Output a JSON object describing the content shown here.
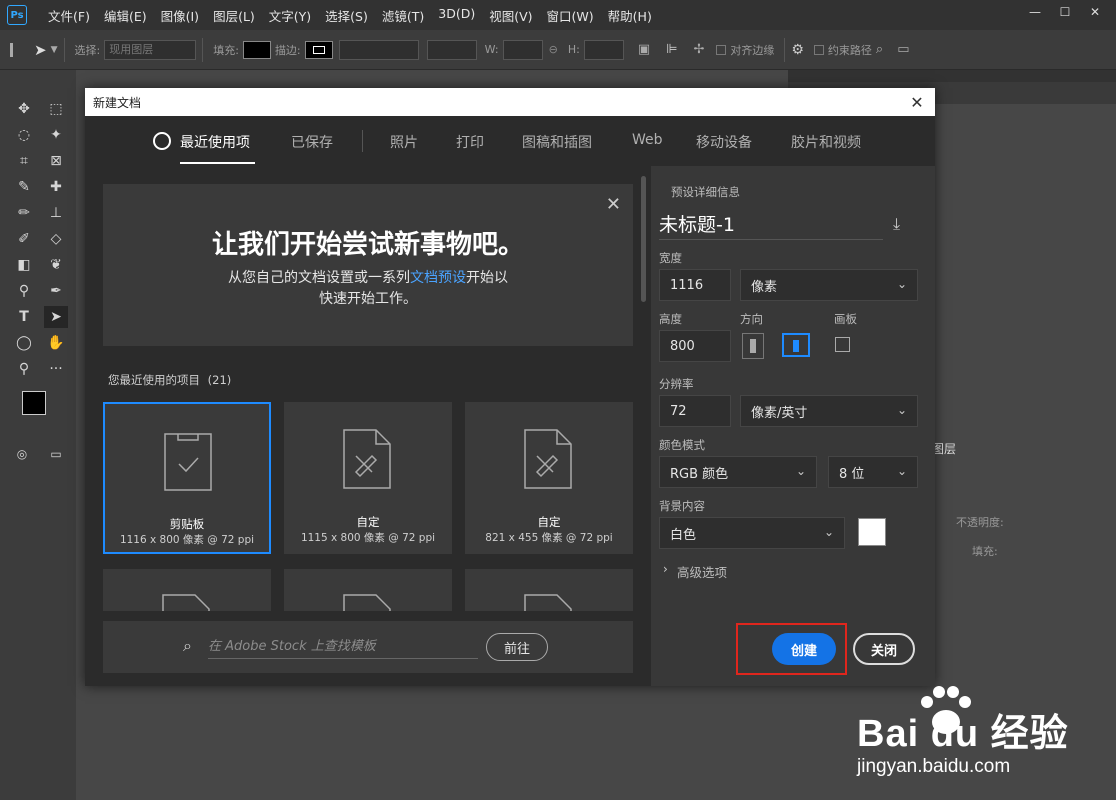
{
  "app": {
    "logo": "Ps"
  },
  "menu": [
    "文件(F)",
    "编辑(E)",
    "图像(I)",
    "图层(L)",
    "文字(Y)",
    "选择(S)",
    "滤镜(T)",
    "3D(D)",
    "视图(V)",
    "窗口(W)",
    "帮助(H)"
  ],
  "window_controls": {
    "minimize": "—",
    "maximize": "☐",
    "close": "✕"
  },
  "options_bar": {
    "select_label": "选择:",
    "select_value": "现用图层",
    "fill_label": "填充:",
    "stroke_label": "描边:",
    "w_label": "W:",
    "h_label": "H:",
    "align_edges": "对齐边缘",
    "constrain_path": "约束路径"
  },
  "layers_panel": {
    "tab": "图层",
    "opacity_label": "不透明度:",
    "fill_label": "填充:"
  },
  "dialog": {
    "title": "新建文档",
    "close": "✕",
    "tabs": [
      {
        "label": "最近使用项",
        "active": true
      },
      {
        "label": "已保存"
      },
      {
        "label": "照片"
      },
      {
        "label": "打印"
      },
      {
        "label": "图稿和插图"
      },
      {
        "label": "Web"
      },
      {
        "label": "移动设备"
      },
      {
        "label": "胶片和视频"
      }
    ],
    "welcome": {
      "title": "让我们开始尝试新事物吧。",
      "sub_1": "从您自己的文档设置或一系列",
      "sub_link": "文档预设",
      "sub_2": "开始以",
      "sub_3": "快速开始工作。",
      "close": "✕"
    },
    "recent_label": "您最近使用的项目",
    "recent_count": "(21)",
    "recent": [
      {
        "name": "剪贴板",
        "size": "1116 x 800 像素 @ 72 ppi",
        "selected": true
      },
      {
        "name": "自定",
        "size": "1115 x 800 像素 @ 72 ppi"
      },
      {
        "name": "自定",
        "size": "821 x 455 像素 @ 72 ppi"
      }
    ],
    "stock": {
      "placeholder": "在 Adobe Stock 上查找模板",
      "button": "前往"
    },
    "preset": {
      "header": "预设详细信息",
      "name": "未标题-1",
      "width_label": "宽度",
      "width": "1116",
      "width_unit": "像素",
      "height_label": "高度",
      "height": "800",
      "orientation_label": "方向",
      "artboard_label": "画板",
      "resolution_label": "分辨率",
      "resolution": "72",
      "resolution_unit": "像素/英寸",
      "color_mode_label": "颜色模式",
      "color_mode": "RGB 颜色",
      "bit_depth": "8 位",
      "background_label": "背景内容",
      "background": "白色",
      "advanced": "高级选项"
    },
    "create": "创建",
    "close_btn": "关闭"
  },
  "watermark": {
    "brand": "Bai du 经验",
    "url": "jingyan.baidu.com"
  },
  "colors": {
    "accent": "#1473e6",
    "highlight": "#e0261d",
    "link": "#4aa3ff"
  }
}
